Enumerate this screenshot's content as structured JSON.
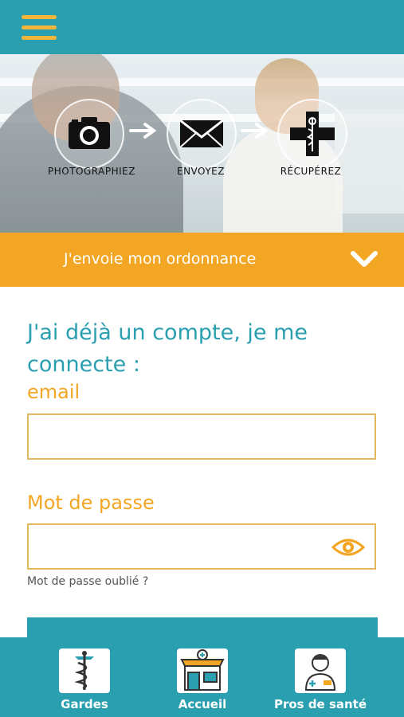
{
  "header": {
    "menu_icon": "hamburger-menu-icon"
  },
  "steps": [
    {
      "label": "PHOTOGRAPHIEZ",
      "icon": "camera-icon"
    },
    {
      "label": "ENVOYEZ",
      "icon": "envelope-icon"
    },
    {
      "label": "RÉCUPÉREZ",
      "icon": "pharmacy-cross-icon"
    }
  ],
  "prescription_bar": {
    "label": "J'envoie mon ordonnance",
    "icon": "chevron-down-icon"
  },
  "login": {
    "title": "J'ai déjà un compte, je me connecte :",
    "email_label": "email",
    "email_value": "",
    "password_label": "Mot de passe",
    "password_value": "",
    "forgot_link": "Mot de passe oublié ?"
  },
  "bottom_nav": [
    {
      "label": "Gardes",
      "icon": "caduceus-icon"
    },
    {
      "label": "Accueil",
      "icon": "pharmacy-store-icon"
    },
    {
      "label": "Pros de santé",
      "icon": "nurse-icon"
    }
  ],
  "colors": {
    "teal": "#2a9fb0",
    "orange": "#f3a623",
    "gold": "#f4b63a"
  }
}
